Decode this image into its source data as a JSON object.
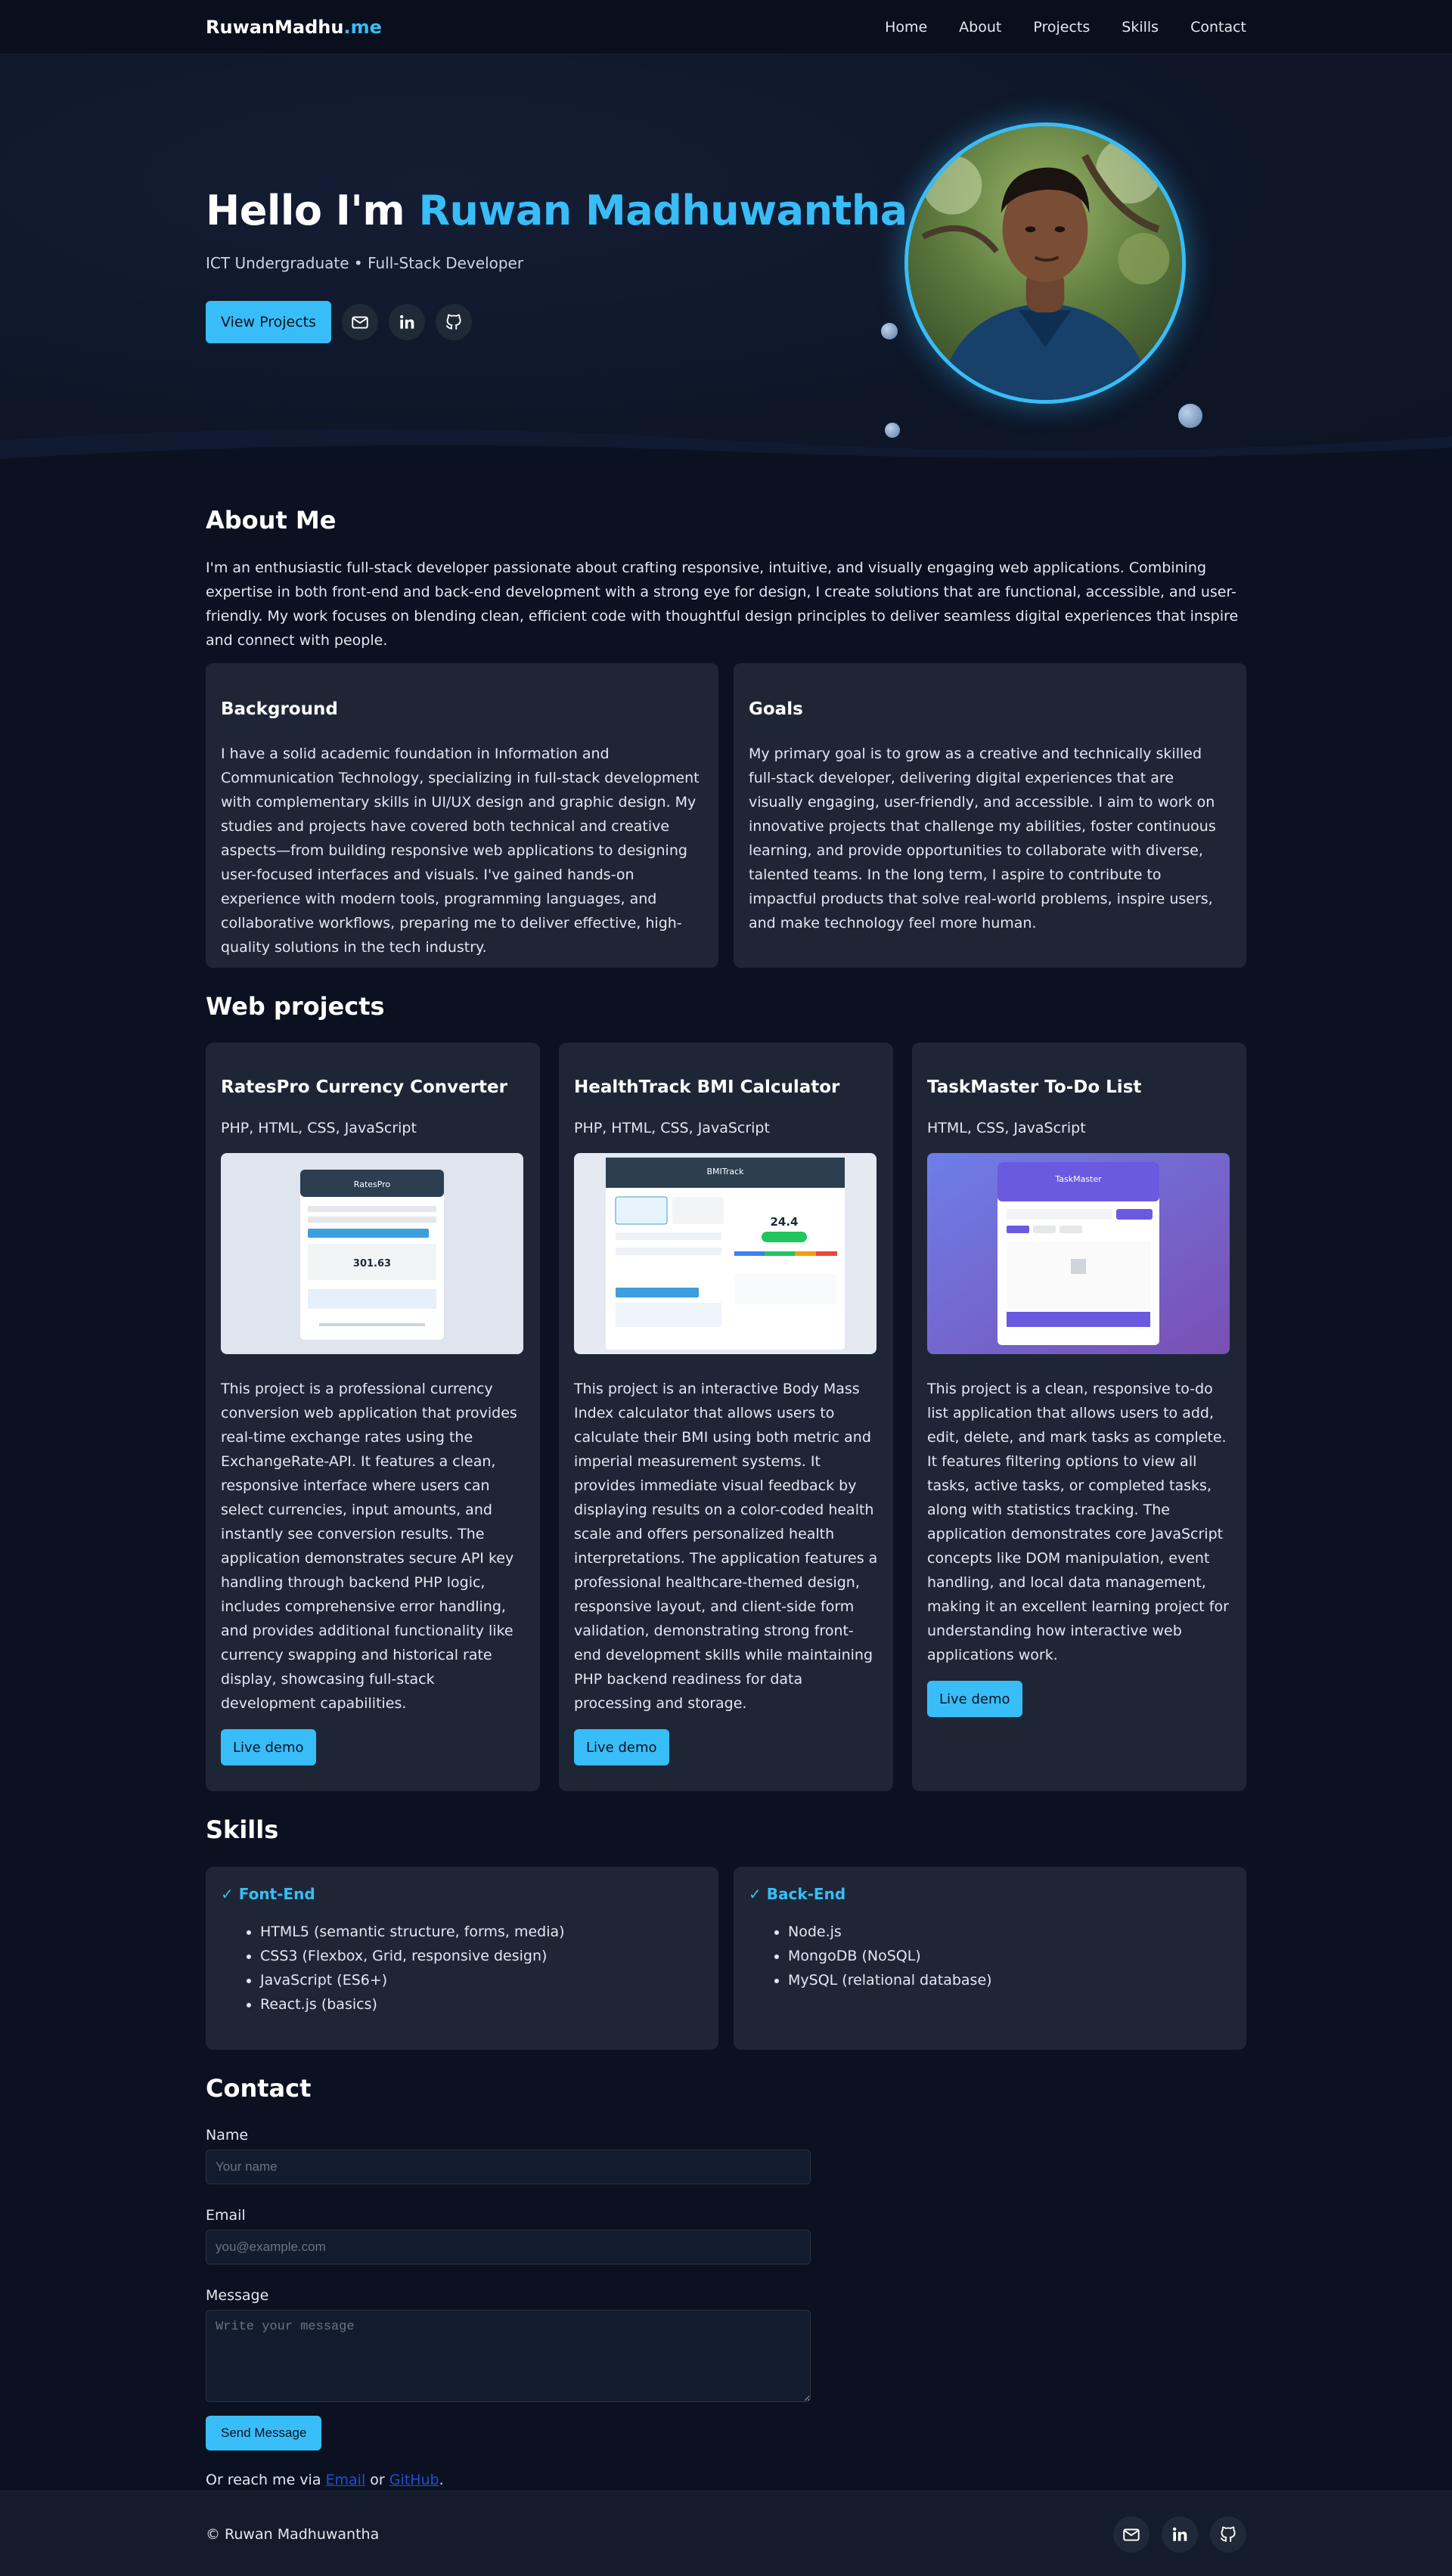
{
  "nav": {
    "brand_main": "RuwanMadhu",
    "brand_accent": ".me",
    "links": [
      "Home",
      "About",
      "Projects",
      "Skills",
      "Contact"
    ]
  },
  "hero": {
    "greeting": "Hello I'm ",
    "name": "Ruwan Madhuwantha",
    "subtitle": "ICT Undergraduate • Full-Stack Developer",
    "cta_label": "View Projects",
    "icons": [
      "mail-icon",
      "linkedin-icon",
      "github-icon"
    ]
  },
  "about": {
    "heading": "About Me",
    "lead": "I'm an enthusiastic full-stack developer passionate about crafting responsive, intuitive, and visually engaging web applications. Combining expertise in both front-end and back-end development with a strong eye for design, I create solutions that are functional, accessible, and user-friendly. My work focuses on blending clean, efficient code with thoughtful design principles to deliver seamless digital experiences that inspire and connect with people.",
    "background_title": "Background",
    "background_text": "I have a solid academic foundation in Information and Communication Technology, specializing in full-stack development with complementary skills in UI/UX design and graphic design. My studies and projects have covered both technical and creative aspects—from building responsive web applications to designing user-focused interfaces and visuals. I've gained hands-on experience with modern tools, programming languages, and collaborative workflows, preparing me to deliver effective, high-quality solutions in the tech industry.",
    "goals_title": "Goals",
    "goals_text": "My primary goal is to grow as a creative and technically skilled full-stack developer, delivering digital experiences that are visually engaging, user-friendly, and accessible. I aim to work on innovative projects that challenge my abilities, foster continuous learning, and provide opportunities to collaborate with diverse, talented teams. In the long term, I aspire to contribute to impactful products that solve real-world problems, inspire users, and make technology feel more human."
  },
  "projects": {
    "heading": "Web projects",
    "items": [
      {
        "title": "RatesPro Currency Converter",
        "tech": "PHP, HTML, CSS, JavaScript",
        "description": "This project is a professional currency conversion web application that provides real-time exchange rates using the ExchangeRate-API. It features a clean, responsive interface where users can select currencies, input amounts, and instantly see conversion results. The application demonstrates secure API key handling through backend PHP logic, includes comprehensive error handling, and provides additional functionality like currency swapping and historical rate display, showcasing full-stack development capabilities.",
        "button": "Live demo",
        "thumb_title": "RatesPro",
        "thumb_value": "301.63"
      },
      {
        "title": "HealthTrack BMI Calculator",
        "tech": "PHP, HTML, CSS, JavaScript",
        "description": "This project is an interactive Body Mass Index calculator that allows users to calculate their BMI using both metric and imperial measurement systems. It provides immediate visual feedback by displaying results on a color-coded health scale and offers personalized health interpretations. The application features a professional healthcare-themed design, responsive layout, and client-side form validation, demonstrating strong front-end development skills while maintaining PHP backend readiness for data processing and storage.",
        "button": "Live demo",
        "thumb_title": "BMITrack",
        "thumb_value": "24.4"
      },
      {
        "title": "TaskMaster To-Do List",
        "tech": "HTML, CSS, JavaScript",
        "description": "This project is a clean, responsive to-do list application that allows users to add, edit, delete, and mark tasks as complete. It features filtering options to view all tasks, active tasks, or completed tasks, along with statistics tracking. The application demonstrates core JavaScript concepts like DOM manipulation, event handling, and local data management, making it an excellent learning project for understanding how interactive web applications work.",
        "button": "Live demo",
        "thumb_title": "TaskMaster"
      }
    ]
  },
  "skills": {
    "heading": "Skills",
    "frontend_title": "✓ Font-End",
    "frontend": [
      "HTML5 (semantic structure, forms, media)",
      "CSS3 (Flexbox, Grid, responsive design)",
      "JavaScript (ES6+)",
      "React.js (basics)"
    ],
    "backend_title": "✓ Back-End",
    "backend": [
      "Node.js",
      "MongoDB (NoSQL)",
      "MySQL (relational database)"
    ]
  },
  "contact": {
    "heading": "Contact",
    "name_label": "Name",
    "name_placeholder": "Your name",
    "email_label": "Email",
    "email_placeholder": "you@example.com",
    "message_label": "Message",
    "message_placeholder": "Write your message",
    "send_label": "Send Message",
    "reach_prefix": "Or reach me via ",
    "reach_email": "Email",
    "reach_or": " or ",
    "reach_github": "GitHub",
    "reach_suffix": "."
  },
  "footer": {
    "copyright": "© Ruwan Madhuwantha"
  },
  "colors": {
    "accent": "#38bdf8",
    "background": "#0b1120",
    "card": "#1e2636"
  }
}
